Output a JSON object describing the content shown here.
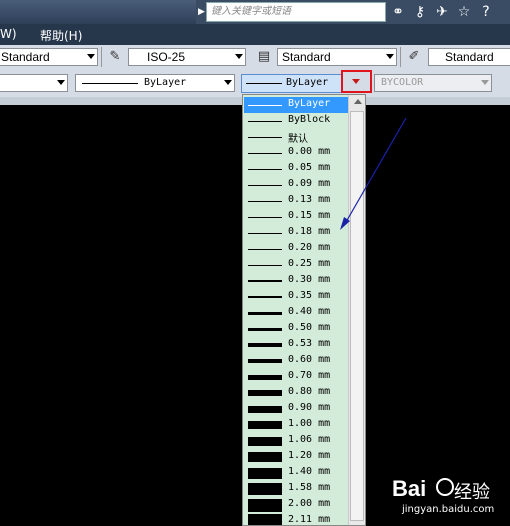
{
  "search": {
    "placeholder": "键入关键字或短语"
  },
  "top_icons": [
    "binoculars-icon",
    "key-icon",
    "satellite-icon",
    "star-icon",
    "help-icon"
  ],
  "menu": {
    "item_w": "W)",
    "item_help": "帮助(H)"
  },
  "toolbar1": {
    "text_style": "Standard",
    "dim_style": "ISO-25",
    "table_style": "Standard",
    "multileader_style": "Standard"
  },
  "toolbar2": {
    "linetype": "ByLayer",
    "lineweight": "ByLayer",
    "plot_style": "BYCOLOR"
  },
  "lineweight_list": {
    "selected_index": 0,
    "items": [
      "ByLayer",
      "ByBlock",
      "默认",
      "0.00 mm",
      "0.05 mm",
      "0.09 mm",
      "0.13 mm",
      "0.15 mm",
      "0.18 mm",
      "0.20 mm",
      "0.25 mm",
      "0.30 mm",
      "0.35 mm",
      "0.40 mm",
      "0.50 mm",
      "0.53 mm",
      "0.60 mm",
      "0.70 mm",
      "0.80 mm",
      "0.90 mm",
      "1.00 mm",
      "1.06 mm",
      "1.20 mm",
      "1.40 mm",
      "1.58 mm",
      "2.00 mm",
      "2.11 mm"
    ],
    "weights": [
      1,
      1,
      1,
      1,
      1,
      1,
      1,
      1,
      1,
      1,
      1,
      2,
      2,
      3,
      3,
      4,
      4,
      5,
      6,
      7,
      8,
      9,
      10,
      11,
      12,
      13,
      14
    ]
  },
  "watermark": {
    "brand": "Bai",
    "product": "经验",
    "url": "jingyan.baidu.com"
  },
  "colors": {
    "accent_red": "#e0141c",
    "arrow_blue": "#1a22a8",
    "list_bg": "#d3ecd9",
    "selected_bg": "#3399ff"
  }
}
